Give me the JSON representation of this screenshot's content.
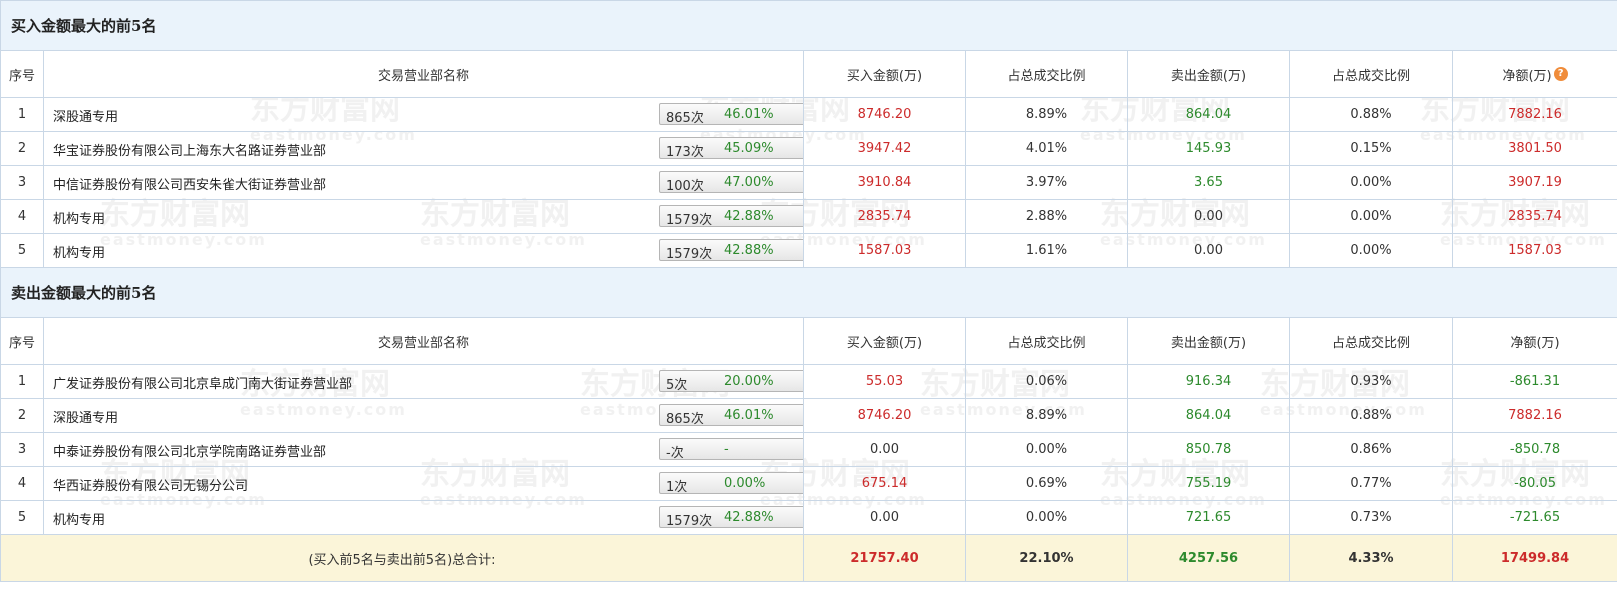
{
  "watermark": {
    "cn": "东方财富网",
    "en": "eastmoney.com"
  },
  "columns": {
    "idx": "序号",
    "name": "交易营业部名称",
    "buy": "买入金额(万)",
    "buy_pct": "占总成交比例",
    "sell": "卖出金额(万)",
    "sell_pct": "占总成交比例",
    "net": "净额(万)"
  },
  "help_glyph": "?",
  "buy_section": {
    "title": "买入金额最大的前5名",
    "rows": [
      {
        "idx": "1",
        "name": "深股通专用",
        "count": "865次",
        "rate": "46.01%",
        "icon": "help-icon",
        "buy": "8746.20",
        "buy_pct": "8.89%",
        "sell": "864.04",
        "sell_pct": "0.88%",
        "net": "7882.16"
      },
      {
        "idx": "2",
        "name": "华宝证券股份有限公司上海东大名路证券营业部",
        "count": "173次",
        "rate": "45.09%",
        "icon": "arrow-icon",
        "buy": "3947.42",
        "buy_pct": "4.01%",
        "sell": "145.93",
        "sell_pct": "0.15%",
        "net": "3801.50"
      },
      {
        "idx": "3",
        "name": "中信证券股份有限公司西安朱雀大街证券营业部",
        "count": "100次",
        "rate": "47.00%",
        "icon": "arrow-icon",
        "buy": "3910.84",
        "buy_pct": "3.97%",
        "sell": "3.65",
        "sell_pct": "0.00%",
        "net": "3907.19"
      },
      {
        "idx": "4",
        "name": "机构专用",
        "count": "1579次",
        "rate": "42.88%",
        "icon": "arrow-icon",
        "buy": "2835.74",
        "buy_pct": "2.88%",
        "sell": "0.00",
        "sell_pct": "0.00%",
        "net": "2835.74"
      },
      {
        "idx": "5",
        "name": "机构专用",
        "count": "1579次",
        "rate": "42.88%",
        "icon": "arrow-icon",
        "buy": "1587.03",
        "buy_pct": "1.61%",
        "sell": "0.00",
        "sell_pct": "0.00%",
        "net": "1587.03"
      }
    ]
  },
  "sell_section": {
    "title": "卖出金额最大的前5名",
    "rows": [
      {
        "idx": "1",
        "name": "广发证券股份有限公司北京阜成门南大街证券营业部",
        "count": "5次",
        "rate": "20.00%",
        "icon": "help-icon",
        "buy": "55.03",
        "buy_pct": "0.06%",
        "sell": "916.34",
        "sell_pct": "0.93%",
        "net": "-861.31"
      },
      {
        "idx": "2",
        "name": "深股通专用",
        "count": "865次",
        "rate": "46.01%",
        "icon": "arrow-icon",
        "buy": "8746.20",
        "buy_pct": "8.89%",
        "sell": "864.04",
        "sell_pct": "0.88%",
        "net": "7882.16"
      },
      {
        "idx": "3",
        "name": "中泰证券股份有限公司北京学院南路证券营业部",
        "count": "-次",
        "rate": "-",
        "icon": "arrow-icon",
        "buy": "0.00",
        "buy_pct": "0.00%",
        "sell": "850.78",
        "sell_pct": "0.86%",
        "net": "-850.78"
      },
      {
        "idx": "4",
        "name": "华西证券股份有限公司无锡分公司",
        "count": "1次",
        "rate": "0.00%",
        "icon": "arrow-icon",
        "buy": "675.14",
        "buy_pct": "0.69%",
        "sell": "755.19",
        "sell_pct": "0.77%",
        "net": "-80.05"
      },
      {
        "idx": "5",
        "name": "机构专用",
        "count": "1579次",
        "rate": "42.88%",
        "icon": "arrow-icon",
        "buy": "0.00",
        "buy_pct": "0.00%",
        "sell": "721.65",
        "sell_pct": "0.73%",
        "net": "-721.65"
      }
    ]
  },
  "total": {
    "label": "(买入前5名与卖出前5名)总合计:",
    "buy": "21757.40",
    "buy_pct": "22.10%",
    "sell": "4257.56",
    "sell_pct": "4.33%",
    "net": "17499.84"
  },
  "colors": {
    "positive": "#cc2b2b",
    "negative": "#2d8a2d",
    "section_bg": "#eaf3fb",
    "total_bg": "#fbf5d9",
    "border": "#c9d7e6",
    "help": "#f08c3a"
  }
}
